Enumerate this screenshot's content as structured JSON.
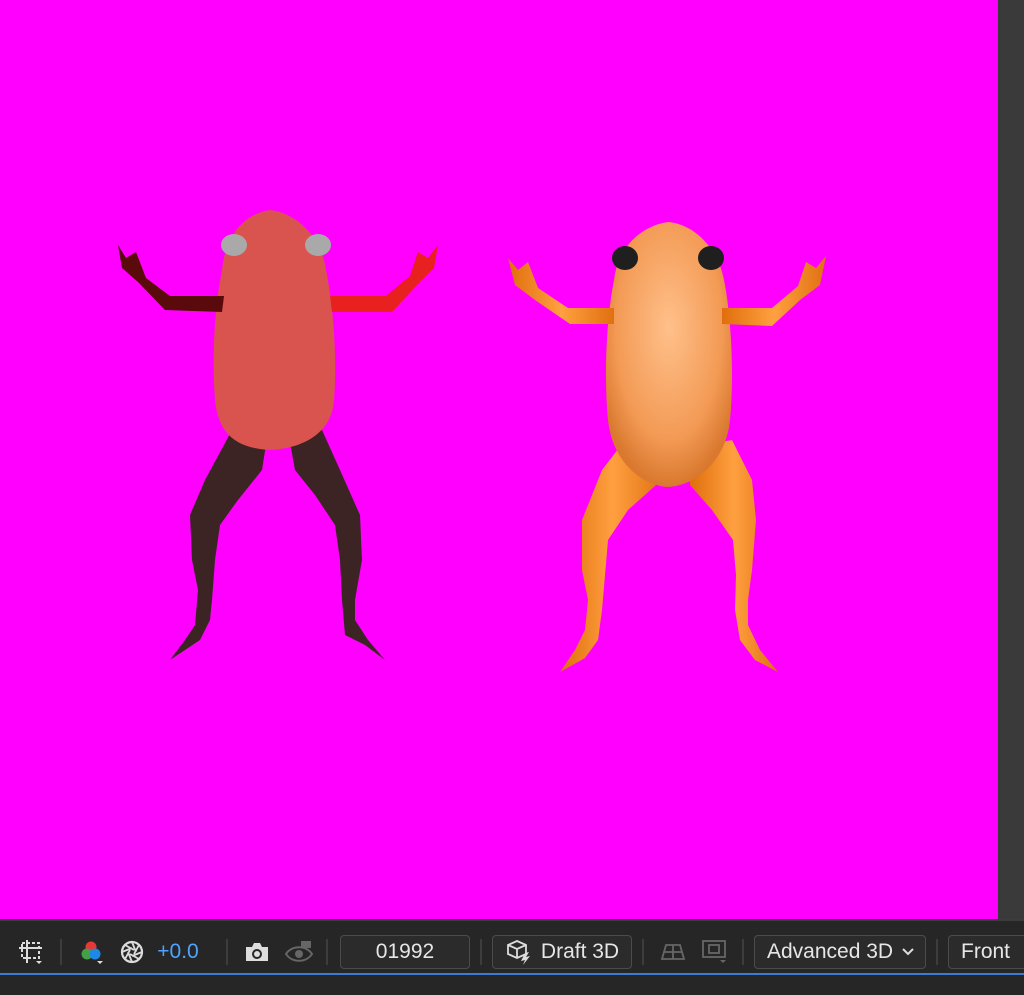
{
  "viewport": {
    "background_color": "#ff00ff",
    "frogs": [
      {
        "name": "frog-flat-shaded",
        "body_color": "#d9544f",
        "arm_left_color": "#5a0a0a",
        "arm_right_color": "#e82020",
        "leg_color": "#3d2424"
      },
      {
        "name": "frog-rendered",
        "body_color": "#f7a35a",
        "limb_color": "#ff8a1c"
      }
    ]
  },
  "toolbar": {
    "region_icon": "region-of-interest-icon",
    "channel_icon": "rgb-channels-icon",
    "exposure_icon": "aperture-icon",
    "exposure_value": "+0.0",
    "snapshot_icon": "camera-icon",
    "show_snapshot_icon": "show-snapshot-icon",
    "timecode": "01992",
    "draft_3d_label": "Draft 3D",
    "renderer_label": "Advanced 3D",
    "view_label": "Front",
    "accent_color": "#4fa3ff"
  }
}
